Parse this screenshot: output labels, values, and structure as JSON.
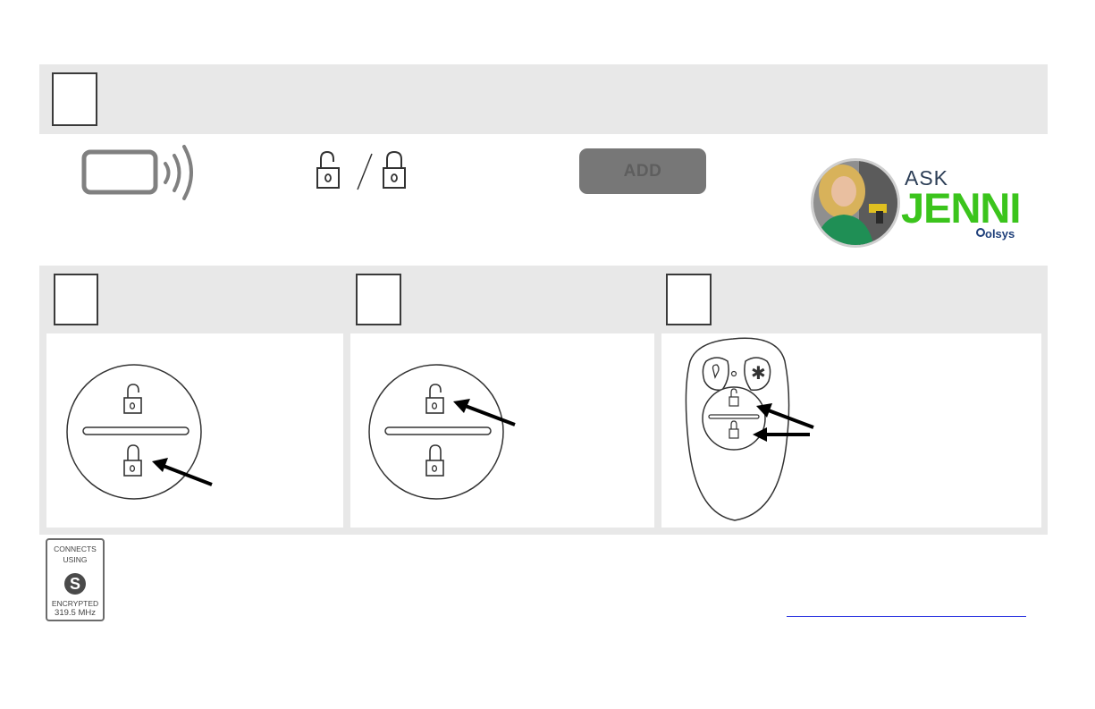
{
  "header": {
    "add_button_label": "ADD"
  },
  "ask_jenni": {
    "ask": "ASK",
    "jenni": "JENNI",
    "brand": "olsys"
  },
  "badge": {
    "line1": "CONNECTS",
    "line2": "USING",
    "logo": "S",
    "line3": "ENCRYPTED",
    "line4": "319.5 MHz"
  },
  "colors": {
    "band_gray": "#e8e8e8",
    "add_button": "#777777",
    "jenni_green": "#3bc41c",
    "link_blue": "#2b35e0",
    "arrow": "#000000"
  },
  "icons": [
    "device-signal-icon",
    "unlock-icon",
    "lock-icon",
    "remote-keyfob-icon",
    "arrow-icon"
  ]
}
